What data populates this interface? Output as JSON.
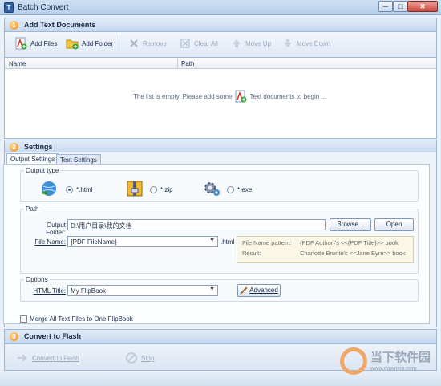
{
  "window": {
    "title": "Batch Convert",
    "min": "─",
    "max": "□",
    "close": "✕"
  },
  "add_section": {
    "number": "1",
    "title": "Add Text Documents",
    "toolbar": {
      "add_files": "Add Files",
      "add_folder": "Add Folder",
      "remove": "Remove",
      "clear_all": "Clear All",
      "move_up": "Move Up",
      "move_down": "Move Down"
    },
    "list": {
      "col_name": "Name",
      "col_path": "Path",
      "empty_before": "The list is empty. Please add some",
      "empty_after": "Text documents to begin ..."
    }
  },
  "settings_section": {
    "number": "2",
    "title": "Settings",
    "tabs": [
      "Output Settings",
      "Text Settings"
    ],
    "output_type": {
      "label": "Output type",
      "options": [
        "*.html",
        "*.zip",
        "*.exe"
      ],
      "selected": "*.html"
    },
    "path": {
      "label": "Path",
      "output_folder_label": "Output Folder:",
      "output_folder_value": "D:\\用户目录\\我的文档",
      "browse": "Browse...",
      "open": "Open",
      "file_name_label": "File Name:",
      "file_name_value": "{PDF FileName}",
      "file_ext": ".html",
      "pattern_label": "File Name pattern:",
      "pattern_value": "{PDF Author}'s <<{PDF Title}>> book",
      "result_label": "Result:",
      "result_value": "Charlotte Bronte's <<Jane Eyre>> book"
    },
    "options": {
      "label": "Options",
      "html_title_label": "HTML Title:",
      "html_title_value": "My FlipBook",
      "advanced": "Advanced"
    },
    "merge_label": "Merge All Text Files to One FlipBook"
  },
  "convert_section": {
    "number": "3",
    "title": "Convert to Flash",
    "convert": "Convert to Flash",
    "stop": "Stop"
  },
  "watermark": {
    "text": "当下软件园",
    "url": "www.downxia.com"
  }
}
